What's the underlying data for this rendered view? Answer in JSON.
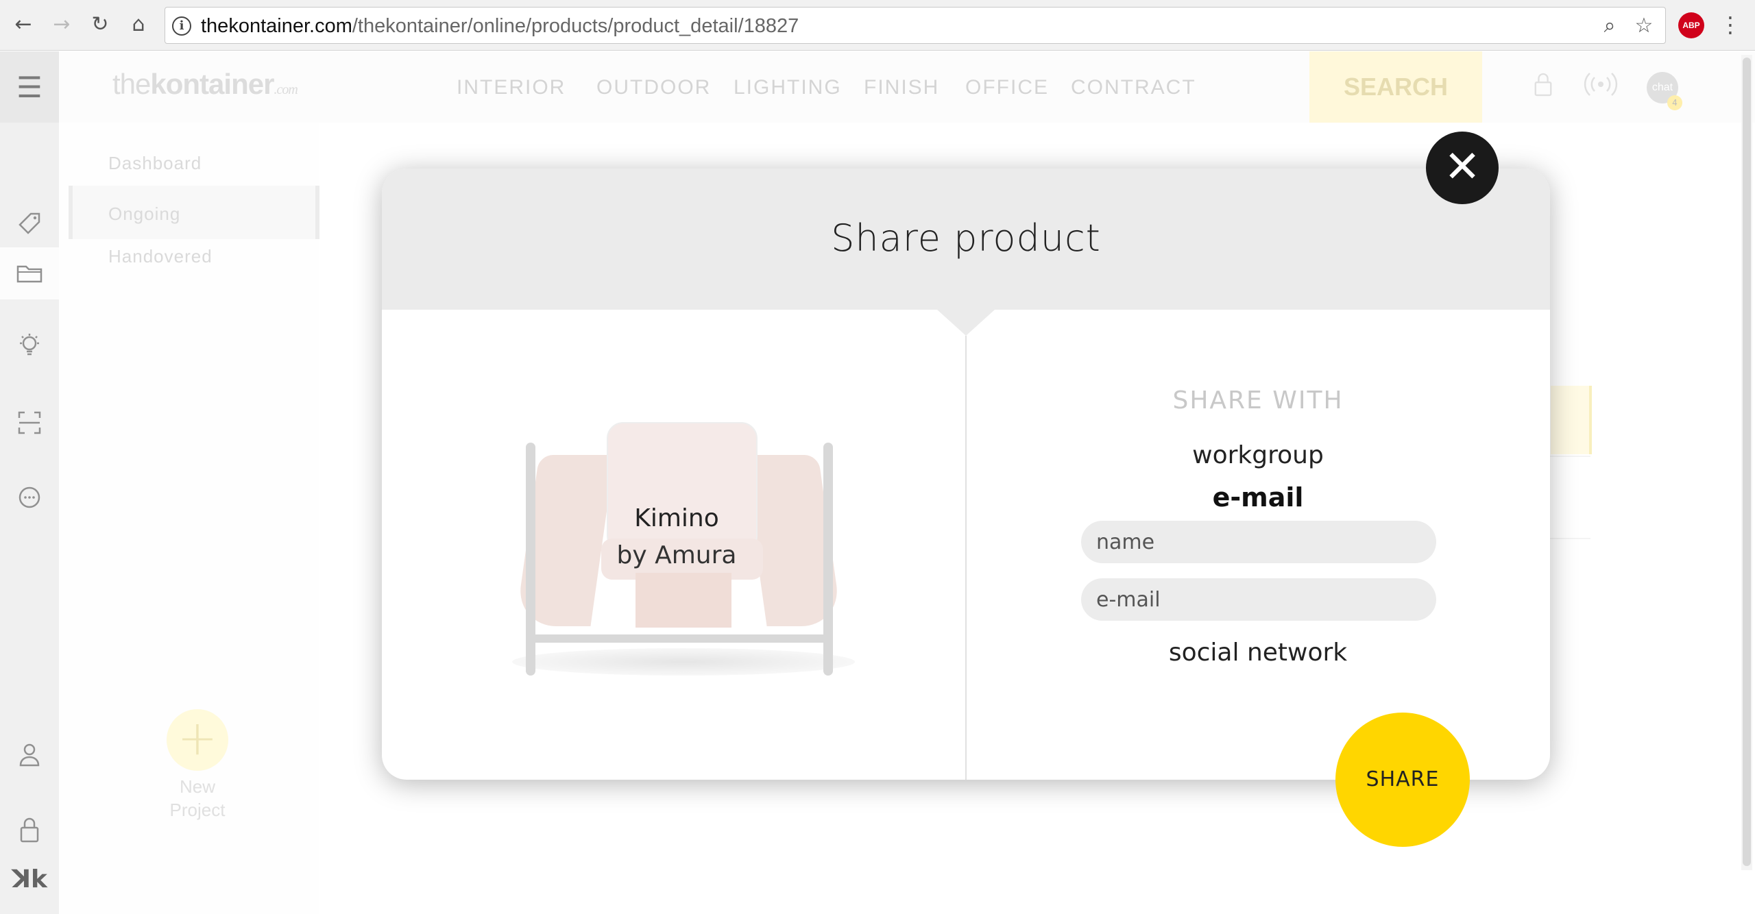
{
  "browser": {
    "back_icon": "←",
    "forward_icon": "→",
    "reload_icon": "↻",
    "home_icon": "⌂",
    "url_domain": "thekontainer.com",
    "url_path": "/thekontainer/online/products/product_detail/18827",
    "info_icon": "i",
    "zoom_icon": "⌕",
    "bookmark_icon": "☆",
    "adblock_label": "ABP",
    "menu_icon": "⋮"
  },
  "app": {
    "brand_light": "the",
    "brand_bold": "kontainer",
    "brand_suffix": ".com",
    "menu": [
      "INTERIOR",
      "OUTDOOR",
      "LIGHTING",
      "FINISH",
      "OFFICE",
      "CONTRACT"
    ],
    "search_label": "SEARCH",
    "chat_label": "chat",
    "chat_badge": "4",
    "rail_logo": "ꓘk",
    "subnav": {
      "dashboard": "Dashboard",
      "ongoing": "Ongoing",
      "handovered": "Handovered"
    },
    "new_project_plus": "+",
    "new_project_label_line1": "New",
    "new_project_label_line2": "Project"
  },
  "modal": {
    "title": "Share product",
    "product_name": "Kimino",
    "product_brand": "by Amura",
    "share_with": "SHARE WITH",
    "option_workgroup": "workgroup",
    "option_email": "e-mail",
    "name_placeholder": "name",
    "email_placeholder": "e-mail",
    "option_social": "social network",
    "share_button": "SHARE",
    "close_icon": "✕"
  },
  "colors": {
    "accent_yellow": "#ffd600",
    "close_black": "#1a1a1a",
    "header_grey": "#ebebeb"
  }
}
